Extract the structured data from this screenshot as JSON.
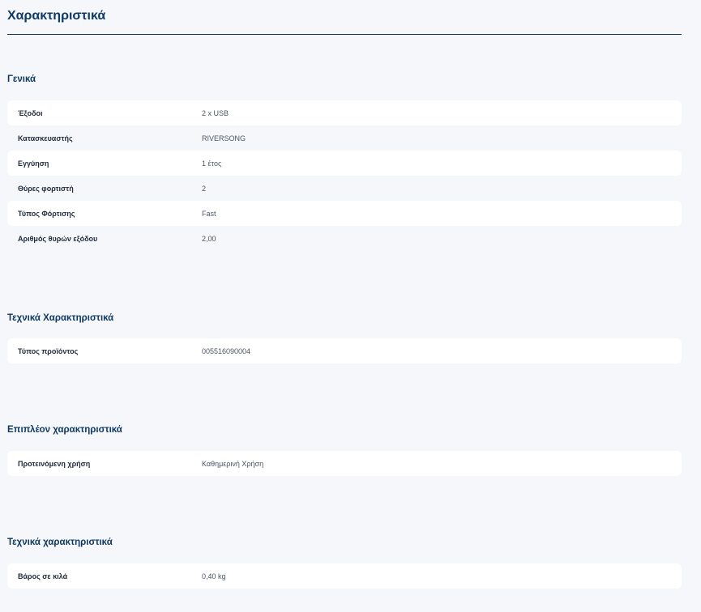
{
  "page": {
    "title": "Χαρακτηριστικά"
  },
  "sections": [
    {
      "heading": "Γενικά",
      "rows": [
        {
          "label": "Έξοδοι",
          "value": "2 x USB"
        },
        {
          "label": "Κατασκευαστής",
          "value": "RIVERSONG"
        },
        {
          "label": "Εγγύηση",
          "value": "1 έτος"
        },
        {
          "label": "Θύρες φορτιστή",
          "value": "2"
        },
        {
          "label": "Τύπος Φόρτισης",
          "value": "Fast"
        },
        {
          "label": "Αριθμός θυρών εξόδου",
          "value": "2,00"
        }
      ]
    },
    {
      "heading": "Τεχνικά Χαρακτηριστικά",
      "rows": [
        {
          "label": "Τύπος προϊόντος",
          "value": "005516090004"
        }
      ]
    },
    {
      "heading": "Επιπλέον χαρακτηριστικά",
      "rows": [
        {
          "label": "Προτεινόμενη χρήση",
          "value": "Καθημερινή Χρήση"
        }
      ]
    },
    {
      "heading": "Τεχνικά χαρακτηριστικά",
      "rows": [
        {
          "label": "Βάρος σε κιλά",
          "value": "0,40 kg"
        }
      ]
    }
  ]
}
